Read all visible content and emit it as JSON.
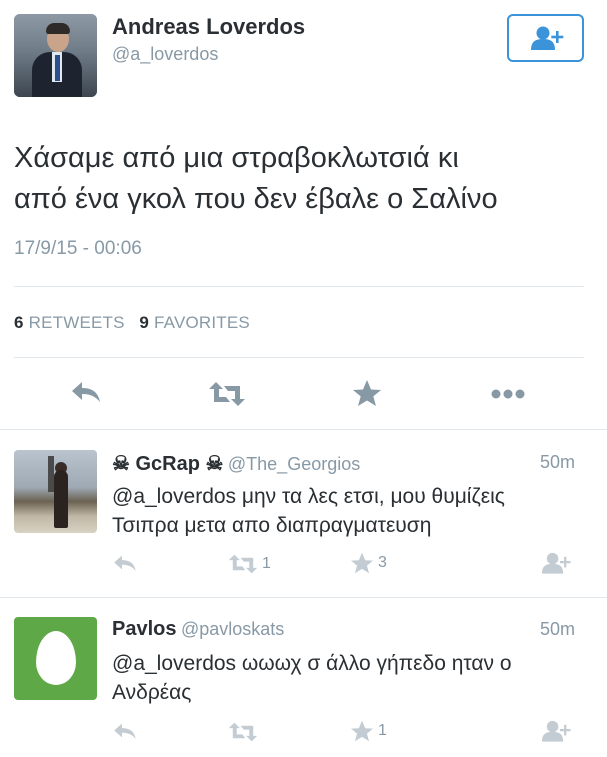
{
  "main_tweet": {
    "name": "Andreas Loverdos",
    "handle": "@a_loverdos",
    "text_line1": "Χάσαμε από μια στραβοκλωτσιά κι",
    "text_line2": "από ένα γκολ που δεν έβαλε ο Σαλίνο",
    "timestamp": "17/9/15 - 00:06",
    "retweets_count": "6",
    "retweets_label": "RETWEETS",
    "favorites_count": "9",
    "favorites_label": "FAVORITES",
    "follow_icon": "follow-user-icon"
  },
  "actions": [
    "reply-icon",
    "retweet-icon",
    "favorite-icon",
    "more-icon"
  ],
  "replies": [
    {
      "name": "☠ GcRap ☠",
      "handle": "@The_Georgios",
      "time": "50m",
      "text_line1": "@a_loverdos μην τα λες ετσι, μου  θυμίζεις",
      "text_line2": "Τσιπρα μετα απο διαπραγματευση",
      "retweets": "1",
      "favorites": "3"
    },
    {
      "name": "Pavlos",
      "handle": "@pavloskats",
      "time": "50m",
      "text_line1": "@a_loverdos ωωωχ σ άλλο γήπεδο ηταν ο",
      "text_line2": "Ανδρέας",
      "retweets": "",
      "favorites": "1"
    }
  ],
  "colors": {
    "accent": "#3b94d9",
    "muted": "#8899a6",
    "text": "#292f33",
    "divider": "#e1e8ed",
    "egg_bg": "#5fa847"
  }
}
